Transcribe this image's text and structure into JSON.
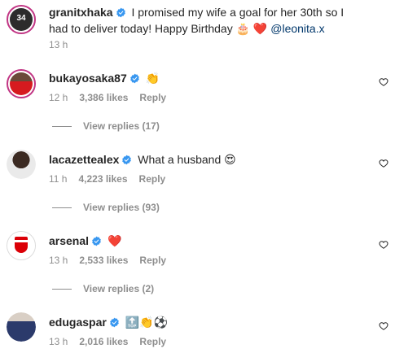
{
  "comments": [
    {
      "username": "granitxhaka",
      "text": "I promised my wife a goal for her 30th so I had to deliver today! Happy Birthday",
      "emoji": "🎂 ❤️",
      "mention": "@leonita.x",
      "time": "13 h",
      "avatar_text": "34"
    },
    {
      "username": "bukayosaka87",
      "text": "👏",
      "time": "12 h",
      "likes": "3,386 likes",
      "reply": "Reply",
      "view_replies": "View replies (17)"
    },
    {
      "username": "lacazettealex",
      "text": "What a husband 😍",
      "time": "11 h",
      "likes": "4,223 likes",
      "reply": "Reply",
      "view_replies": "View replies (93)"
    },
    {
      "username": "arsenal",
      "text": "❤️",
      "time": "13 h",
      "likes": "2,533 likes",
      "reply": "Reply",
      "view_replies": "View replies (2)",
      "avatar_text": "ARSENAL"
    },
    {
      "username": "edugaspar",
      "text": "🔝👏⚽",
      "time": "13 h",
      "likes": "2,016 likes",
      "reply": "Reply"
    }
  ],
  "colors": {
    "verified": "#3897f0",
    "story_ring": "#c13584",
    "muted": "#8e8e8e",
    "mention": "#00376b"
  },
  "icons": {
    "verified": "verified-badge-icon",
    "like": "heart-outline-icon"
  }
}
